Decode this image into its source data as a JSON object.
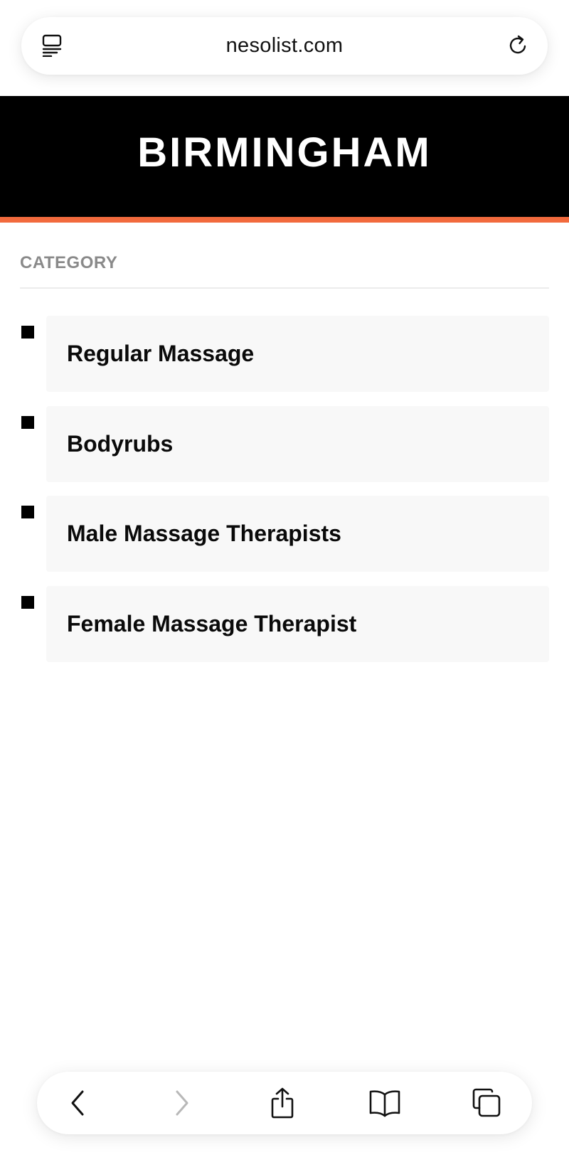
{
  "browser": {
    "url": "nesolist.com",
    "icons": {
      "reader": "reader-mode-icon",
      "reload": "reload-icon"
    }
  },
  "header": {
    "title": "BIRMINGHAM",
    "accent_color": "#f26a3d"
  },
  "category": {
    "heading": "CATEGORY",
    "items": [
      {
        "label": "Regular Massage"
      },
      {
        "label": "Bodyrubs"
      },
      {
        "label": "Male Massage Therapists"
      },
      {
        "label": "Female Massage Therapist"
      }
    ]
  },
  "toolbar": {
    "icons": [
      "back-icon",
      "forward-icon",
      "share-icon",
      "bookmarks-icon",
      "tabs-icon"
    ],
    "forward_enabled": false
  }
}
